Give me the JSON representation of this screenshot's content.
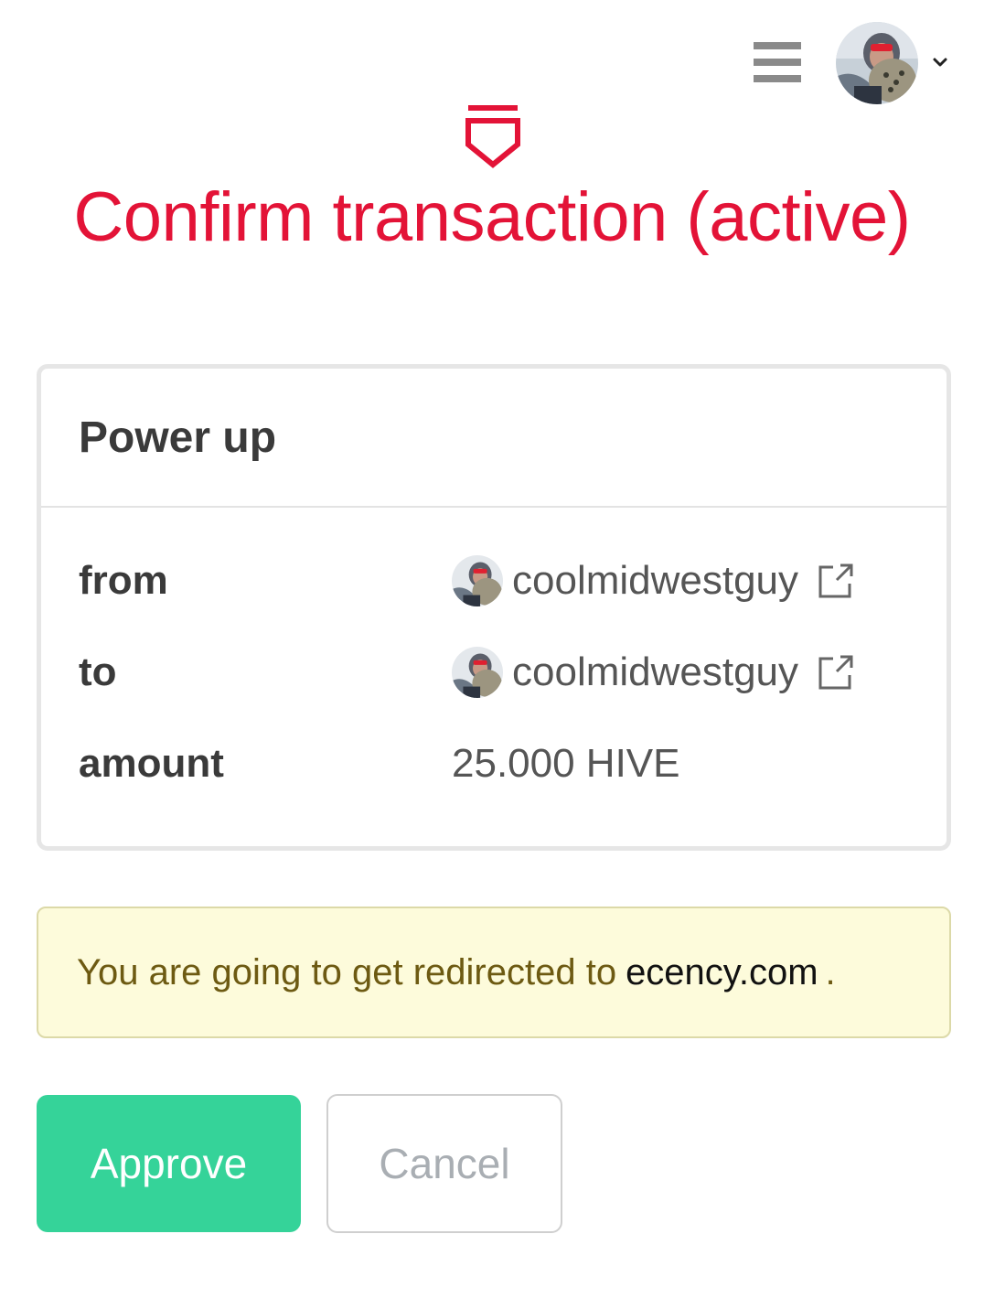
{
  "header": {
    "menu_icon": "hamburger-menu-icon",
    "account_avatar_icon": "user-avatar",
    "dropdown_icon": "chevron-down-icon"
  },
  "heading": {
    "logo_icon": "hive-shield-icon",
    "title": "Confirm transaction (active)",
    "accent_color": "#e31337"
  },
  "operation": {
    "title": "Power up",
    "fields": [
      {
        "label": "from",
        "value": "coolmidwestguy",
        "icon": "external-link-icon"
      },
      {
        "label": "to",
        "value": "coolmidwestguy",
        "icon": "external-link-icon"
      },
      {
        "label": "amount",
        "value": "25.000 HIVE"
      }
    ]
  },
  "notice": {
    "text": "You are going to get redirected to",
    "domain": "ecency.com",
    "suffix": "."
  },
  "actions": {
    "approve_label": "Approve",
    "cancel_label": "Cancel",
    "approve_color": "#35d399"
  }
}
